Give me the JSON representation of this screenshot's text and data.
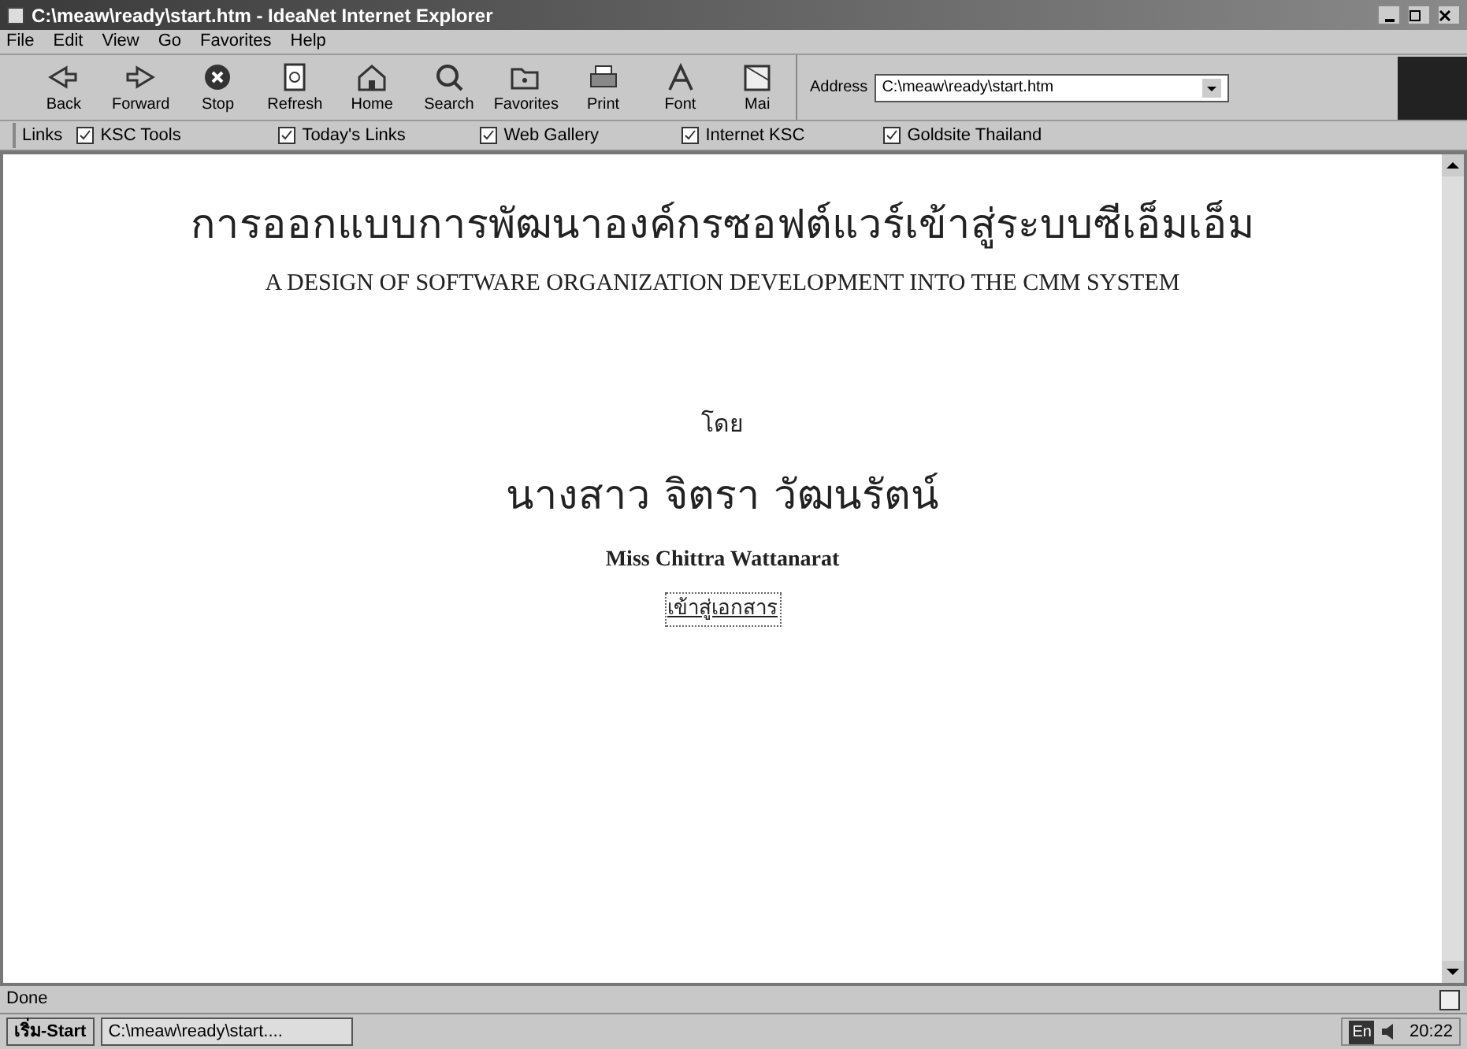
{
  "window": {
    "title": "C:\\meaw\\ready\\start.htm - IdeaNet Internet Explorer"
  },
  "menu": [
    "File",
    "Edit",
    "View",
    "Go",
    "Favorites",
    "Help"
  ],
  "toolbar": [
    {
      "label": "Back",
      "kind": "back"
    },
    {
      "label": "Forward",
      "kind": "forward"
    },
    {
      "label": "Stop",
      "kind": "stop"
    },
    {
      "label": "Refresh",
      "kind": "refresh"
    },
    {
      "label": "Home",
      "kind": "home"
    },
    {
      "label": "Search",
      "kind": "search"
    },
    {
      "label": "Favorites",
      "kind": "favorites"
    },
    {
      "label": "Print",
      "kind": "print"
    },
    {
      "label": "Font",
      "kind": "font"
    },
    {
      "label": "Mai",
      "kind": "mail"
    }
  ],
  "address": {
    "label": "Address",
    "value": "C:\\meaw\\ready\\start.htm"
  },
  "links": {
    "label": "Links",
    "items": [
      "KSC Tools",
      "Today's Links",
      "Web Gallery",
      "Internet KSC",
      "Goldsite Thailand"
    ]
  },
  "content": {
    "title_thai": "การออกแบบการพัฒนาองค์กรซอฟต์แวร์เข้าสู่ระบบซีเอ็มเอ็ม",
    "title_english": "A DESIGN OF SOFTWARE ORGANIZATION DEVELOPMENT INTO THE CMM SYSTEM",
    "by": "โดย",
    "author_thai": "นางสาว จิตรา วัฒนรัตน์",
    "author_english": "Miss Chittra Wattanarat",
    "link": "เข้าสู่เอกสาร"
  },
  "status_bar": {
    "text": "Done"
  },
  "taskbar": {
    "start": "เริ่ม-Start",
    "tasks": [
      "C:\\meaw\\ready\\start...."
    ],
    "tray_language": "En",
    "clock": "20:22"
  }
}
